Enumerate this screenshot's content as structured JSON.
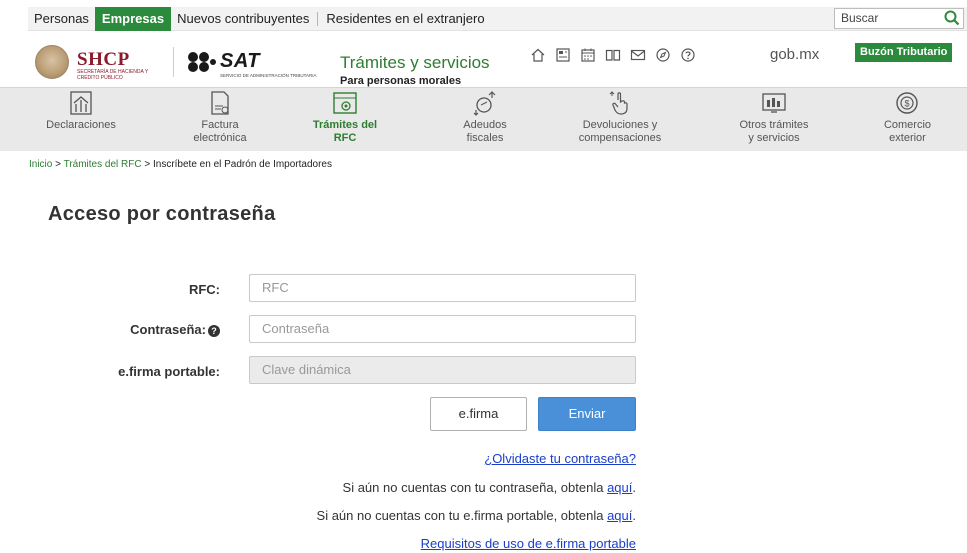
{
  "topnav": {
    "items": [
      "Personas",
      "Empresas",
      "Nuevos contribuyentes",
      "Residentes en el extranjero"
    ],
    "search_placeholder": "Buscar"
  },
  "header": {
    "shcp_title": "SHCP",
    "shcp_sub": "SECRETARÍA DE HACIENDA Y CRÉDITO PÚBLICO",
    "sat_title": "SAT",
    "sat_sub": "SERVICIO DE ADMINISTRACIÓN TRIBUTARIA",
    "tramites_title": "Trámites y servicios",
    "tramites_sub": "Para personas morales",
    "gobmx": "gob.mx",
    "buzon": "Buzón Tributario",
    "icons": [
      "home-icon",
      "calculator-icon",
      "calendar-icon",
      "book-icon",
      "mail-icon",
      "compass-icon",
      "help-circle-icon"
    ]
  },
  "categories": [
    {
      "line1": "Declaraciones",
      "line2": "",
      "icon": "declaraciones-icon"
    },
    {
      "line1": "Factura",
      "line2": "electrónica",
      "icon": "factura-icon"
    },
    {
      "line1": "Trámites del",
      "line2": "RFC",
      "icon": "rfc-icon"
    },
    {
      "line1": "Adeudos",
      "line2": "fiscales",
      "icon": "adeudos-icon"
    },
    {
      "line1": "Devoluciones y",
      "line2": "compensaciones",
      "icon": "devoluciones-icon"
    },
    {
      "line1": "Otros trámites",
      "line2": "y servicios",
      "icon": "otros-icon"
    },
    {
      "line1": "Comercio",
      "line2": "exterior",
      "icon": "comercio-icon"
    }
  ],
  "breadcrumb": {
    "home": "Inicio",
    "section": "Trámites del RFC",
    "current": "Inscríbete en el Padrón de Importadores",
    "sep": ">"
  },
  "page": {
    "title": "Acceso por contraseña"
  },
  "form": {
    "rfc_label": "RFC:",
    "rfc_placeholder": "RFC",
    "password_label": "Contraseña:",
    "password_placeholder": "Contraseña",
    "efirma_label": "e.firma portable:",
    "efirma_placeholder": "Clave dinámica",
    "btn_efirma": "e.firma",
    "btn_enviar": "Enviar"
  },
  "links": {
    "forgot": "¿Olvidaste tu contraseña?",
    "no_password_text": "Si aún no cuentas con tu contraseña, obtenla ",
    "no_efirma_text": "Si aún no cuentas con tu e.firma portable, obtenla ",
    "here": "aquí",
    "period": ".",
    "requisitos": "Requisitos de uso de e.firma portable"
  },
  "colors": {
    "green": "#2c8a3c",
    "blue_button": "#4a90d9",
    "link": "#1a3ec9",
    "shcp": "#8b1a2b"
  }
}
